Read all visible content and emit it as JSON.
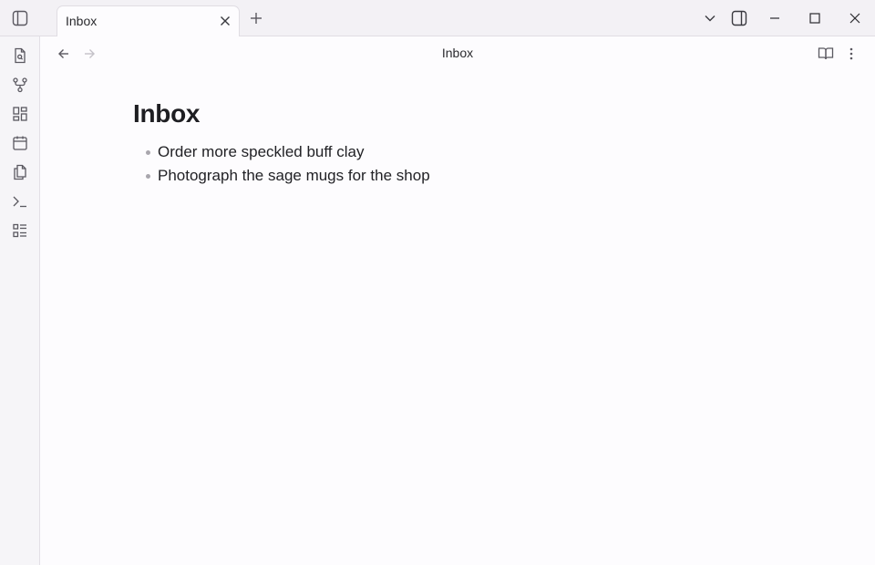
{
  "titlebar": {
    "tabs": [
      {
        "label": "Inbox",
        "active": true
      }
    ],
    "icons": {
      "sidebar_toggle": "sidebar-left-toggle-icon",
      "tab_close": "close-icon",
      "new_tab": "plus-icon",
      "tab_list": "chevron-down-icon",
      "right_sidebar": "sidebar-right-toggle-icon",
      "minimize": "minimize-icon",
      "maximize": "maximize-icon",
      "close_window": "close-icon"
    }
  },
  "ribbon": {
    "items": [
      {
        "name": "quick-switcher",
        "icon": "file-search-icon"
      },
      {
        "name": "graph-view",
        "icon": "git-fork-icon"
      },
      {
        "name": "canvas",
        "icon": "layout-grid-icon"
      },
      {
        "name": "daily-note",
        "icon": "calendar-icon"
      },
      {
        "name": "templates",
        "icon": "files-icon"
      },
      {
        "name": "command-palette",
        "icon": "terminal-icon"
      },
      {
        "name": "bases",
        "icon": "list-checks-icon"
      }
    ]
  },
  "view": {
    "title": "Inbox",
    "icons": {
      "back": "arrow-left-icon",
      "forward": "arrow-right-icon",
      "reading_view": "book-open-icon",
      "more": "more-vertical-icon"
    }
  },
  "document": {
    "heading": "Inbox",
    "bullets": [
      "Order more speckled buff clay",
      "Photograph the sage mugs for the shop"
    ]
  },
  "colors": {
    "background": "#fdfcfe",
    "titlebar": "#f3f1f5",
    "ribbon": "#f6f5f8",
    "text": "#222226",
    "muted_icon": "#5a5860"
  }
}
